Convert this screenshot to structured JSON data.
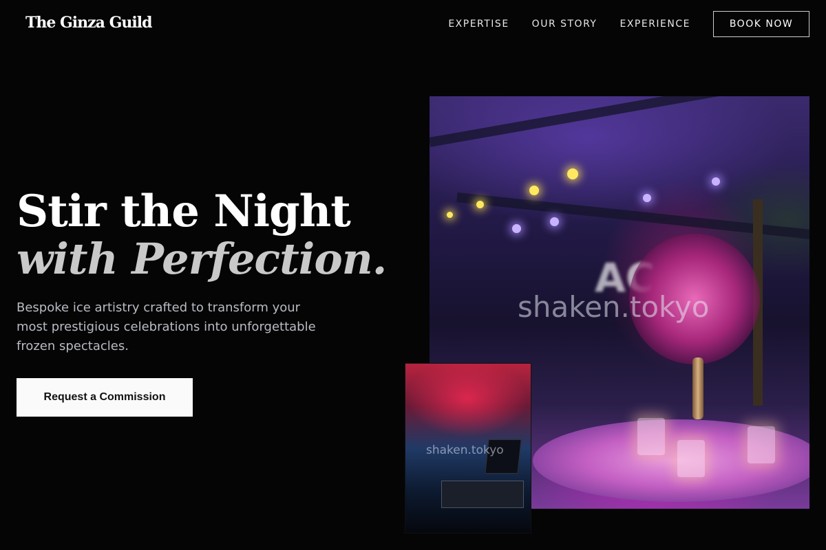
{
  "brand": {
    "name": "The Ginza Guild"
  },
  "nav": {
    "items": [
      {
        "label": "EXPERTISE"
      },
      {
        "label": "OUR STORY"
      },
      {
        "label": "EXPERIENCE"
      }
    ],
    "book_label": "BOOK NOW"
  },
  "hero": {
    "headline_line1": "Stir the Night",
    "headline_line2": "with Perfection.",
    "subtext": "Bespoke ice artistry crafted to transform your most prestigious celebrations into unforgettable frozen spectacles.",
    "cta_label": "Request a Commission"
  },
  "images": {
    "main_watermark": "shaken.tokyo",
    "small_watermark": "shaken.tokyo",
    "main_sign_text": "AC"
  },
  "colors": {
    "background": "#050505",
    "cta_bg": "#fafafa",
    "headline_italic": "#c9c9c9"
  }
}
